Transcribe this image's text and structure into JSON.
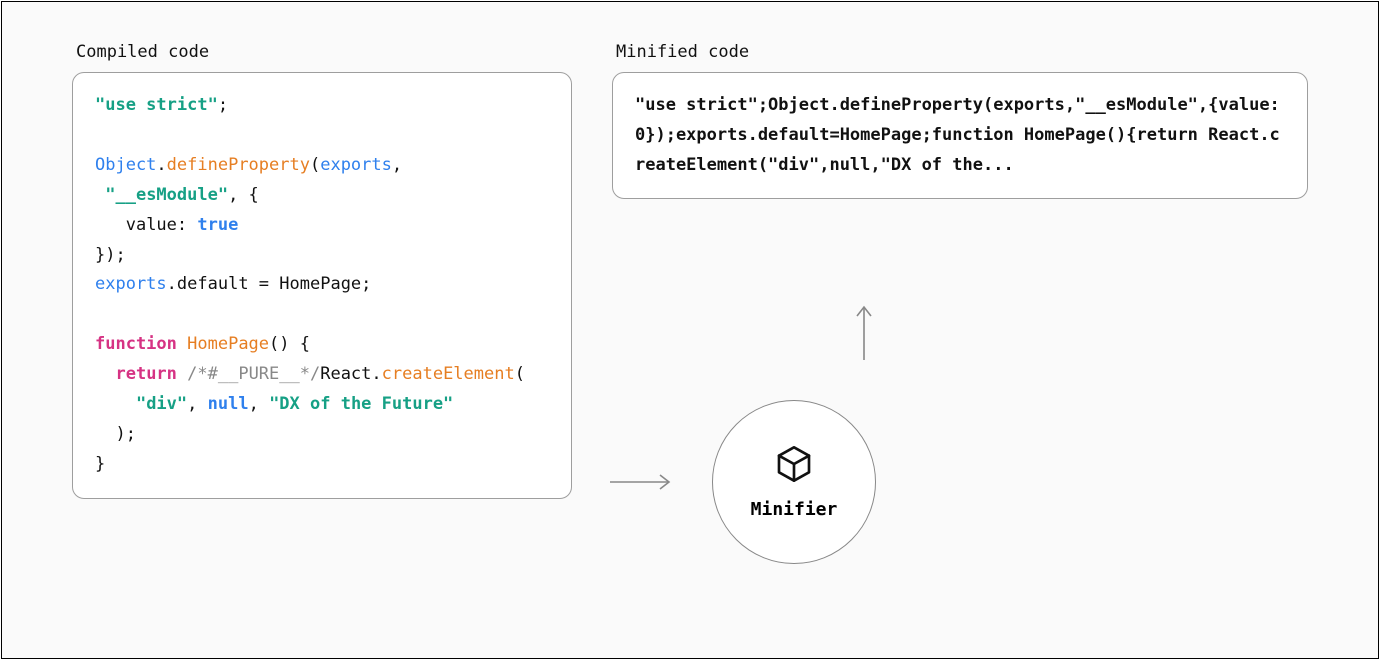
{
  "left": {
    "label": "Compiled code",
    "code": {
      "use_strict": "\"use strict\"",
      "obj": "Object",
      "defineProperty": "defineProperty",
      "exportsIdent": "exports",
      "esModule": "\"__esModule\"",
      "valueKey": "value",
      "trueLit": "true",
      "defaultKey": "default",
      "homePageIdent": "HomePage",
      "functionKw": "function",
      "returnKw": "return",
      "pureComment": "/*#__PURE__*/",
      "reactIdent": "React",
      "createElement": "createElement",
      "divStr": "\"div\"",
      "nullLit": "null",
      "textStr": "\"DX of the Future\""
    }
  },
  "right": {
    "label": "Minified code",
    "code": "\"use strict\";Object.defineProperty(exports,\"__esModule\",{value:0});exports.default=HomePage;function HomePage(){return React.createElement(\"div\",null,\"DX of the..."
  },
  "minifier": {
    "label": "Minifier"
  }
}
